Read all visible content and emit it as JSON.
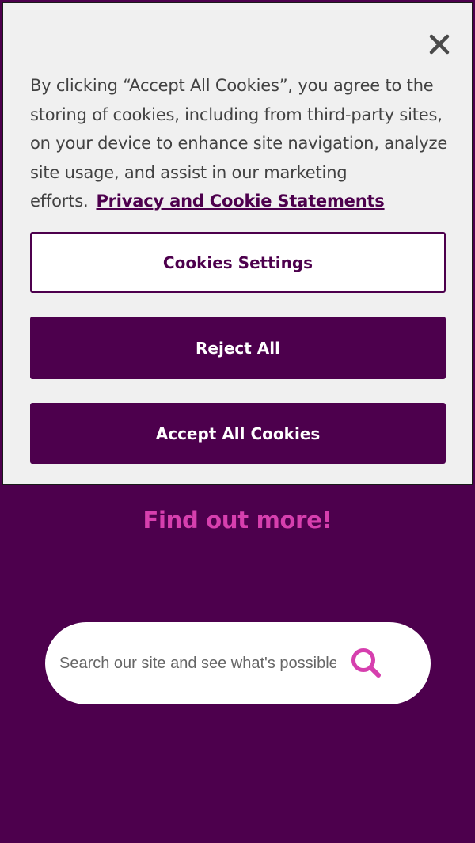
{
  "page": {
    "background_color": "#4d004d",
    "accent_color": "#d63fae",
    "cta_title": "Find out more!"
  },
  "search": {
    "placeholder": "Search our site and see what's possible",
    "value": "",
    "icon": "search-icon"
  },
  "cookie_banner": {
    "background_color": "#f0f0f0",
    "close_icon": "close-icon",
    "text": "By clicking “Accept All Cookies”, you agree to the storing of cookies, including from third-party sites, on your device to enhance site navigation, analyze site usage, and assist in our marketing efforts.",
    "link_text": "Privacy and Cookie Statements",
    "buttons": {
      "settings_label": "Cookies Settings",
      "reject_label": "Reject All",
      "accept_label": "Accept All Cookies"
    },
    "button_color": "#4d004d"
  }
}
